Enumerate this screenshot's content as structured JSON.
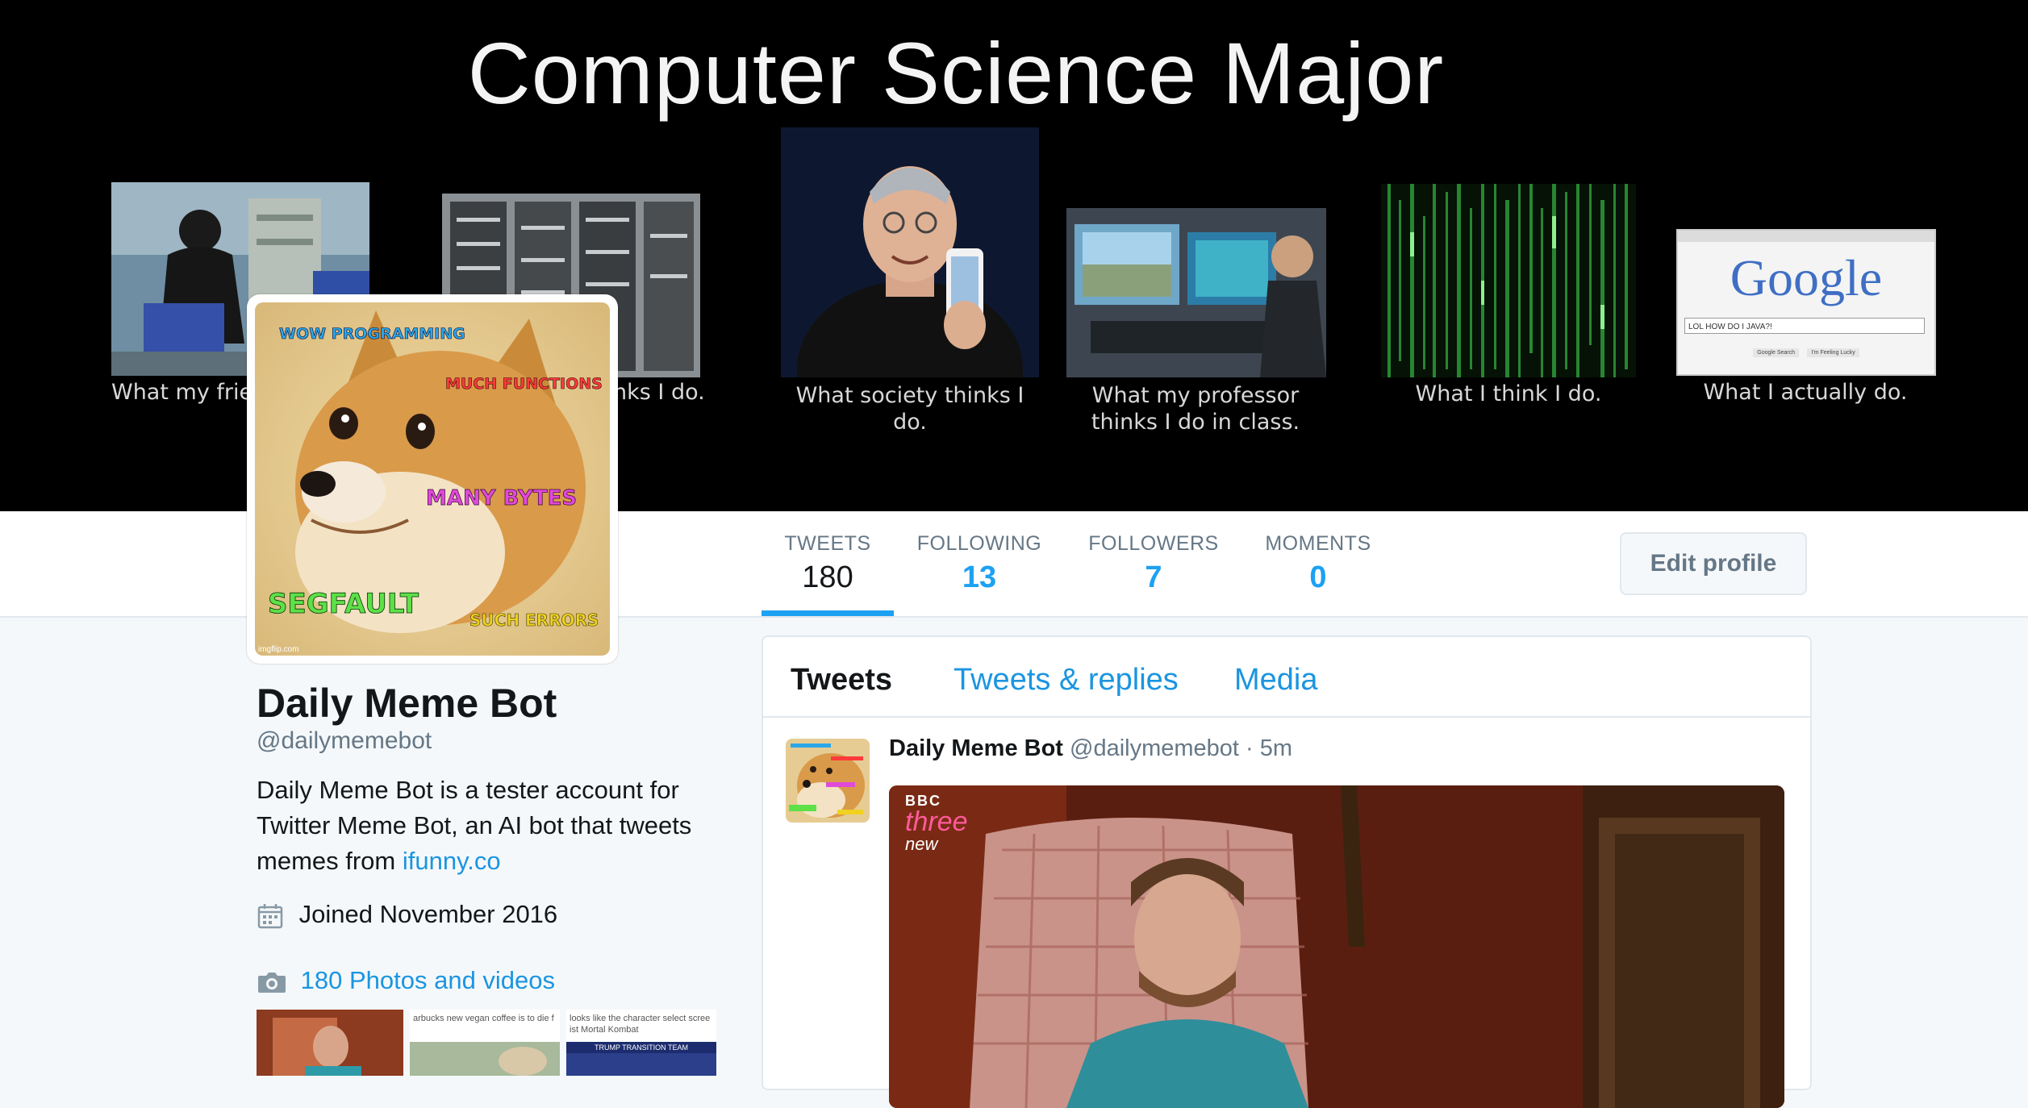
{
  "banner": {
    "title": "Computer Science Major",
    "captions": [
      "What my frien",
      "nks I do.",
      "What society thinks I do.",
      "What my professor thinks I do in class.",
      "What I think I do.",
      "What I actually do."
    ],
    "google_logo": "Google",
    "google_query": "LOL HOW DO I JAVA?!",
    "google_btn1": "Google Search",
    "google_btn2": "I'm Feeling Lucky",
    "bbc_logo_top": "BBC",
    "bbc_logo_mid": "three",
    "bbc_logo_bot": "new"
  },
  "avatar": {
    "labels": [
      "WOW PROGRAMMING",
      "MUCH FUNCTIONS",
      "MANY BYTES",
      "SEGFAULT",
      "SUCH ERRORS"
    ],
    "watermark": "imgflip.com"
  },
  "nav": {
    "stats": [
      {
        "label": "TWEETS",
        "value": "180"
      },
      {
        "label": "FOLLOWING",
        "value": "13"
      },
      {
        "label": "FOLLOWERS",
        "value": "7"
      },
      {
        "label": "MOMENTS",
        "value": "0"
      }
    ],
    "edit_profile": "Edit profile"
  },
  "profile": {
    "name": "Daily Meme Bot",
    "handle": "@dailymemebot",
    "bio_text": "Daily Meme Bot is a tester account for Twitter Meme Bot, an AI bot that tweets memes from ",
    "bio_link": "ifunny.co",
    "joined": "Joined November 2016",
    "photos": "180 Photos and videos",
    "thumb_texts": [
      "",
      "arbucks new vegan coffee is to die f",
      "looks like the character select scree",
      "ist Mortal Kombat",
      "TRUMP TRANSITION TEAM"
    ]
  },
  "timeline": {
    "tabs": [
      "Tweets",
      "Tweets & replies",
      "Media"
    ],
    "tweet": {
      "name": "Daily Meme Bot",
      "handle": "@dailymemebot",
      "separator": "·",
      "time": "5m"
    }
  },
  "colors": {
    "accent": "#1da1f2",
    "link": "#1b95e0",
    "muted": "#657786"
  }
}
